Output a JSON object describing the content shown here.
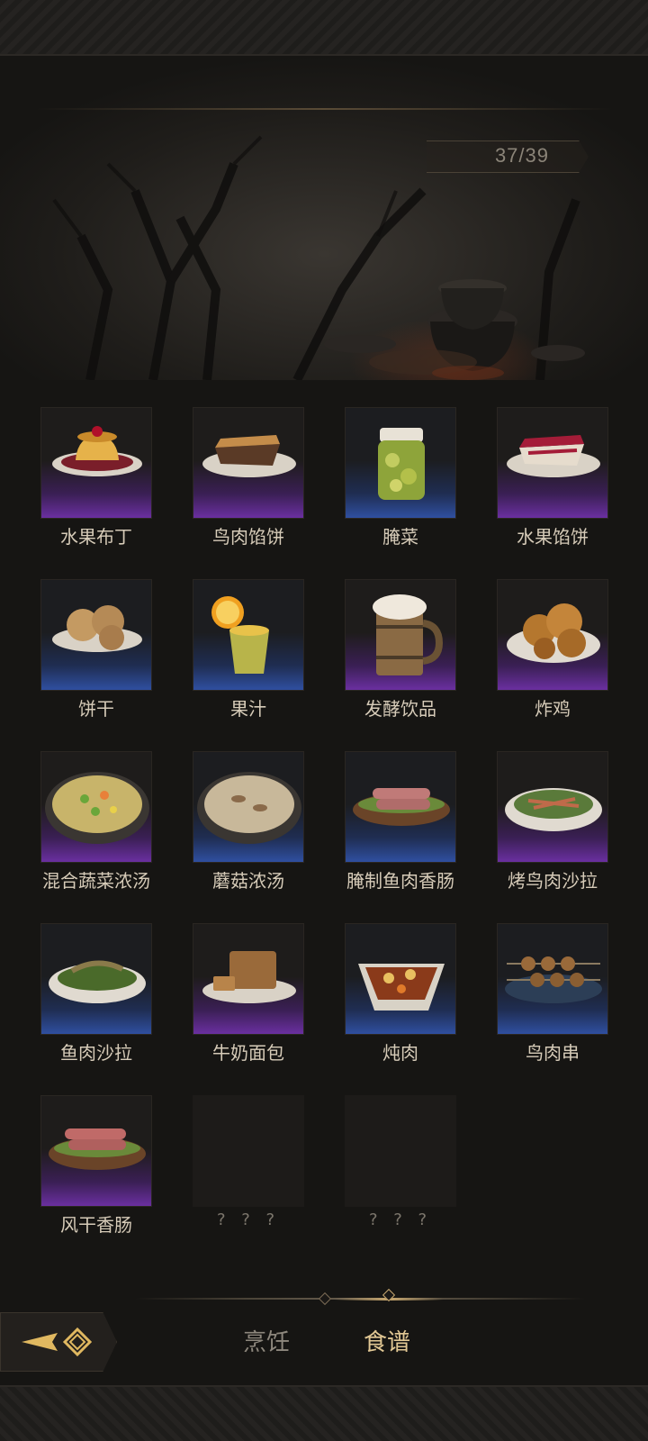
{
  "header": {
    "counter": "37/39"
  },
  "recipes": [
    {
      "name": "水果布丁",
      "rarity": "purple",
      "icon": "fruit-pudding-icon"
    },
    {
      "name": "鸟肉馅饼",
      "rarity": "purple",
      "icon": "bird-meat-pie-icon"
    },
    {
      "name": "腌菜",
      "rarity": "blue",
      "icon": "pickles-jar-icon"
    },
    {
      "name": "水果馅饼",
      "rarity": "purple",
      "icon": "fruit-pie-icon"
    },
    {
      "name": "饼干",
      "rarity": "blue",
      "icon": "biscuits-icon"
    },
    {
      "name": "果汁",
      "rarity": "blue",
      "icon": "juice-cup-icon"
    },
    {
      "name": "发酵饮品",
      "rarity": "purple",
      "icon": "beer-mug-icon"
    },
    {
      "name": "炸鸡",
      "rarity": "purple",
      "icon": "fried-chicken-icon"
    },
    {
      "name": "混合蔬菜浓汤",
      "rarity": "purple",
      "icon": "vegetable-soup-icon"
    },
    {
      "name": "蘑菇浓汤",
      "rarity": "blue",
      "icon": "mushroom-soup-icon"
    },
    {
      "name": "腌制鱼肉香肠",
      "rarity": "blue",
      "icon": "fish-sausage-icon"
    },
    {
      "name": "烤鸟肉沙拉",
      "rarity": "purple",
      "icon": "roast-bird-salad-icon"
    },
    {
      "name": "鱼肉沙拉",
      "rarity": "blue",
      "icon": "fish-salad-icon"
    },
    {
      "name": "牛奶面包",
      "rarity": "purple",
      "icon": "milk-bread-icon"
    },
    {
      "name": "炖肉",
      "rarity": "blue",
      "icon": "stew-icon"
    },
    {
      "name": "鸟肉串",
      "rarity": "blue",
      "icon": "bird-skewer-icon"
    },
    {
      "name": "风干香肠",
      "rarity": "purple",
      "icon": "dried-sausage-icon"
    },
    {
      "name": "? ? ?",
      "rarity": "locked",
      "icon": ""
    },
    {
      "name": "? ? ?",
      "rarity": "locked",
      "icon": ""
    }
  ],
  "tabs": {
    "cook": "烹饪",
    "recipe": "食谱",
    "active": "recipe"
  },
  "colors": {
    "purple": "#6a2fa0",
    "blue": "#2f4fa0",
    "gold": "#e2c894"
  },
  "back_icon": "back-arrow-icon"
}
